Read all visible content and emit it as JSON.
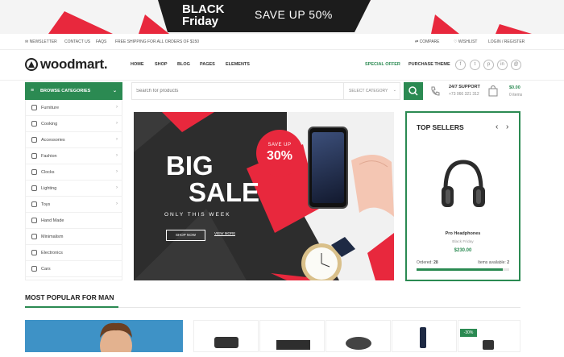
{
  "promo": {
    "line1": "BLACK",
    "line2": "Friday",
    "save": "SAVE UP 50%"
  },
  "topbar": {
    "newsletter": "NEWSLETTER",
    "contact": "CONTACT US",
    "faqs": "FAQS",
    "shipping": "FREE SHIPPING FOR ALL ORDERS OF $150",
    "compare": "COMPARE",
    "wishlist": "WISHLIST",
    "login": "LOGIN / REGISTER"
  },
  "header": {
    "logo": "woodmart.",
    "nav": [
      "HOME",
      "SHOP",
      "BLOG",
      "PAGES",
      "ELEMENTS"
    ],
    "special_offer": "SPECIAL OFFER",
    "purchase": "PURCHASE THEME",
    "social": [
      "f",
      "t",
      "p",
      "in",
      "@"
    ]
  },
  "categories": {
    "title": "BROWSE CATEGORIES",
    "items": [
      {
        "label": "Furniture",
        "arrow": true
      },
      {
        "label": "Cooking",
        "arrow": true
      },
      {
        "label": "Accessories",
        "arrow": true
      },
      {
        "label": "Fashion",
        "arrow": true
      },
      {
        "label": "Clocks",
        "arrow": true
      },
      {
        "label": "Lighting",
        "arrow": true
      },
      {
        "label": "Toys",
        "arrow": true
      },
      {
        "label": "Hand Made",
        "arrow": false
      },
      {
        "label": "Minimalism",
        "arrow": false
      },
      {
        "label": "Electronics",
        "arrow": false
      },
      {
        "label": "Cars",
        "arrow": false
      }
    ]
  },
  "search": {
    "placeholder": "Search for products",
    "category": "SELECT CATEGORY"
  },
  "support": {
    "label": "24/7 SUPPORT",
    "phone": "+73 066 321 312"
  },
  "cart": {
    "total": "$0.00",
    "items": "0 items"
  },
  "hero": {
    "line1": "BIG",
    "line2": "SALE",
    "subtitle": "ONLY THIS WEEK",
    "save_small": "SAVE UP",
    "save_big": "30%",
    "shop_now": "SHOP NOW",
    "view_more": "VIEW MORE"
  },
  "top_sellers": {
    "title": "TOP SELLERS",
    "product": "Pro Headphones",
    "sub": "Black Friday",
    "price": "$230.00",
    "ordered_label": "Ordered:",
    "ordered": "28",
    "available_label": "Items available:",
    "available": "2",
    "progress": 0.93
  },
  "popular": {
    "title": "MOST POPULAR FOR MAN",
    "badge": "-30%"
  },
  "colors": {
    "accent": "#2b8a52",
    "sale_red": "#e8283d"
  }
}
